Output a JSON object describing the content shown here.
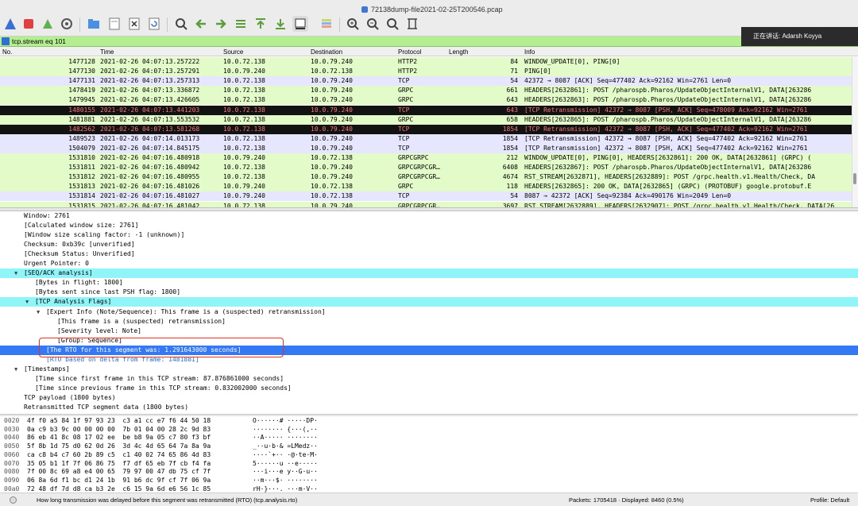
{
  "window": {
    "title": "72138dump-file2021-02-25T200546.pcap"
  },
  "notification": {
    "text": "正在讲话: Adarsh Koyya"
  },
  "filter": {
    "value": "tcp.stream eq 101"
  },
  "columns": [
    "No.",
    "Time",
    "Source",
    "Destination",
    "Protocol",
    "Length",
    "Info"
  ],
  "packets": [
    {
      "no": "1477128",
      "time": "2021-02-26 04:07:13.257222",
      "src": "10.0.72.138",
      "dst": "10.0.79.240",
      "proto": "HTTP2",
      "len": "84",
      "info": "WINDOW_UPDATE[0], PING[0]",
      "style": "g"
    },
    {
      "no": "1477130",
      "time": "2021-02-26 04:07:13.257291",
      "src": "10.0.79.240",
      "dst": "10.0.72.138",
      "proto": "HTTP2",
      "len": "71",
      "info": "PING[0]",
      "style": "g"
    },
    {
      "no": "1477131",
      "time": "2021-02-26 04:07:13.257313",
      "src": "10.0.72.138",
      "dst": "10.0.79.240",
      "proto": "TCP",
      "len": "54",
      "info": "42372 → 8087 [ACK] Seq=477402 Ack=92162 Win=2761 Len=0",
      "style": "l"
    },
    {
      "no": "1478419",
      "time": "2021-02-26 04:07:13.336872",
      "src": "10.0.72.138",
      "dst": "10.0.79.240",
      "proto": "GRPC",
      "len": "661",
      "info": "HEADERS[2632861]: POST /pharospb.Pharos/UpdateObjectInternalV1, DATA[263286",
      "style": "g"
    },
    {
      "no": "1479945",
      "time": "2021-02-26 04:07:13.426605",
      "src": "10.0.72.138",
      "dst": "10.0.79.240",
      "proto": "GRPC",
      "len": "643",
      "info": "HEADERS[2632863]: POST /pharospb.Pharos/UpdateObjectInternalV1, DATA[263286",
      "style": "g"
    },
    {
      "no": "1480155",
      "time": "2021-02-26 04:07:13.441203",
      "src": "10.0.72.138",
      "dst": "10.0.79.240",
      "proto": "TCP",
      "len": "643",
      "info": "[TCP Retransmission] 42372 → 8087 [PSH, ACK] Seq=478009 Ack=92162 Win=2761",
      "style": "k"
    },
    {
      "no": "1481881",
      "time": "2021-02-26 04:07:13.553532",
      "src": "10.0.72.138",
      "dst": "10.0.79.240",
      "proto": "GRPC",
      "len": "658",
      "info": "HEADERS[2632865]: POST /pharospb.Pharos/UpdateObjectInternalV1, DATA[263286",
      "style": "g"
    },
    {
      "no": "1482562",
      "time": "2021-02-26 04:07:13.581268",
      "src": "10.0.72.138",
      "dst": "10.0.79.240",
      "proto": "TCP",
      "len": "1854",
      "info": "[TCP Retransmission] 42372 → 8087 [PSH, ACK] Seq=477402 Ack=92162 Win=2761",
      "style": "k"
    },
    {
      "no": "1489523",
      "time": "2021-02-26 04:07:14.013173",
      "src": "10.0.72.138",
      "dst": "10.0.79.240",
      "proto": "TCP",
      "len": "1854",
      "info": "[TCP Retransmission] 42372 → 8087 [PSH, ACK] Seq=477402 Ack=92162 Win=2761",
      "style": "l"
    },
    {
      "no": "1504079",
      "time": "2021-02-26 04:07:14.845175",
      "src": "10.0.72.138",
      "dst": "10.0.79.240",
      "proto": "TCP",
      "len": "1854",
      "info": "[TCP Retransmission] 42372 → 8087 [PSH, ACK] Seq=477402 Ack=92162 Win=2761",
      "style": "l"
    },
    {
      "no": "1531810",
      "time": "2021-02-26 04:07:16.480918",
      "src": "10.0.79.240",
      "dst": "10.0.72.138",
      "proto": "GRPCGRPC",
      "len": "212",
      "info": "WINDOW_UPDATE[0], PING[0], HEADERS[2632861]: 200 OK, DATA[2632861] (GRPC) (",
      "style": "g"
    },
    {
      "no": "1531811",
      "time": "2021-02-26 04:07:16.480942",
      "src": "10.0.72.138",
      "dst": "10.0.79.240",
      "proto": "GRPCGRPCGR…",
      "len": "6408",
      "info": "HEADERS[2632867]: POST /pharospb.Pharos/UpdateObjectInternalV1, DATA[263286",
      "style": "g"
    },
    {
      "no": "1531812",
      "time": "2021-02-26 04:07:16.480955",
      "src": "10.0.72.138",
      "dst": "10.0.79.240",
      "proto": "GRPCGRPCGR…",
      "len": "4674",
      "info": "RST_STREAM[2632871], HEADERS[2632889]: POST /grpc.health.v1.Health/Check, DA",
      "style": "g"
    },
    {
      "no": "1531813",
      "time": "2021-02-26 04:07:16.481026",
      "src": "10.0.79.240",
      "dst": "10.0.72.138",
      "proto": "GRPC",
      "len": "118",
      "info": "HEADERS[2632865]: 200 OK, DATA[2632865] (GRPC) (PROTOBUF) google.protobuf.E",
      "style": "g"
    },
    {
      "no": "1531814",
      "time": "2021-02-26 04:07:16.481027",
      "src": "10.0.79.240",
      "dst": "10.0.72.138",
      "proto": "TCP",
      "len": "54",
      "info": "8087 → 42372 [ACK] Seq=92384 Ack=490176 Win=2049 Len=0",
      "style": "l"
    },
    {
      "no": "1531815",
      "time": "2021-02-26 04:07:16.481042",
      "src": "10.0.72.138",
      "dst": "10.0.79.240",
      "proto": "GRPCGRPCGR…",
      "len": "3697",
      "info": "RST_STREAM[2632889], HEADERS[2632907]: POST /grpc.health.v1.Health/Check, DATA[26",
      "style": "g"
    }
  ],
  "details": [
    {
      "text": "Window: 2761",
      "indent": 0,
      "tri": "",
      "style": ""
    },
    {
      "text": "[Calculated window size: 2761]",
      "indent": 0,
      "tri": "",
      "style": ""
    },
    {
      "text": "[Window size scaling factor: -1 (unknown)]",
      "indent": 0,
      "tri": "",
      "style": ""
    },
    {
      "text": "Checksum: 0xb39c [unverified]",
      "indent": 0,
      "tri": "",
      "style": ""
    },
    {
      "text": "[Checksum Status: Unverified]",
      "indent": 0,
      "tri": "",
      "style": ""
    },
    {
      "text": "Urgent Pointer: 0",
      "indent": 0,
      "tri": "",
      "style": ""
    },
    {
      "text": "[SEQ/ACK analysis]",
      "indent": 0,
      "tri": "▼",
      "style": "cy"
    },
    {
      "text": "[Bytes in flight: 1800]",
      "indent": 1,
      "tri": "",
      "style": ""
    },
    {
      "text": "[Bytes sent since last PSH flag: 1800]",
      "indent": 1,
      "tri": "",
      "style": ""
    },
    {
      "text": "[TCP Analysis Flags]",
      "indent": 1,
      "tri": "▼",
      "style": "cy"
    },
    {
      "text": "[Expert Info (Note/Sequence): This frame is a (suspected) retransmission]",
      "indent": 2,
      "tri": "▼",
      "style": ""
    },
    {
      "text": "[This frame is a (suspected) retransmission]",
      "indent": 3,
      "tri": "",
      "style": ""
    },
    {
      "text": "[Severity level: Note]",
      "indent": 3,
      "tri": "",
      "style": ""
    },
    {
      "text": "[Group: Sequence]",
      "indent": 3,
      "tri": "",
      "style": ""
    },
    {
      "text": "[The RTO for this segment was: 1.291643000 seconds]",
      "indent": 2,
      "tri": "",
      "style": "sel"
    },
    {
      "text": "[RTO based on delta from frame: 1481881]",
      "indent": 2,
      "tri": "",
      "style": "lnk"
    },
    {
      "text": "[Timestamps]",
      "indent": 0,
      "tri": "▼",
      "style": ""
    },
    {
      "text": "[Time since first frame in this TCP stream: 87.876861000 seconds]",
      "indent": 1,
      "tri": "",
      "style": ""
    },
    {
      "text": "[Time since previous frame in this TCP stream: 0.832002000 seconds]",
      "indent": 1,
      "tri": "",
      "style": ""
    },
    {
      "text": "TCP payload (1800 bytes)",
      "indent": 0,
      "tri": "",
      "style": ""
    },
    {
      "text": "Retransmitted TCP segment data (1800 bytes)",
      "indent": 0,
      "tri": "",
      "style": ""
    }
  ],
  "bytes": [
    {
      "off": "0020",
      "hex": "4f f0 a5 84 1f 97 93 23  c3 a1 cc e7 f6 44 50 18",
      "asc": "O······# ·····DP·"
    },
    {
      "off": "0030",
      "hex": "0a c9 b3 9c 00 00 00 00  7b 01 04 00 28 2c 9d 83",
      "asc": "········ {···(,··"
    },
    {
      "off": "0040",
      "hex": "86 eb 41 8c 08 17 02 ee  be b8 9a 05 c7 80 f3 bf",
      "asc": "··A····· ········"
    },
    {
      "off": "0050",
      "hex": "5f 8b 1d 75 d0 62 0d 26  3d 4c 4d 65 64 7a 8a 9a",
      "asc": "_··u·b·& =LMedz··"
    },
    {
      "off": "0060",
      "hex": "ca c8 b4 c7 60 2b 89 c5  c1 40 02 74 65 86 4d 83",
      "asc": "····`+·· ·@·te·M·"
    },
    {
      "off": "0070",
      "hex": "35 05 b1 1f 7f 06 86 75  f7 df 65 eb 7f cb f4 fa",
      "asc": "5······u ··e·····"
    },
    {
      "off": "0080",
      "hex": "7f 00 8c 69 a8 e4 00 65  79 97 00 47 db 75 cf 7f",
      "asc": "···i···e y··G·u··"
    },
    {
      "off": "0090",
      "hex": "06 8a 6d f1 bc d1 24 1b  91 b6 dc 9f cf 7f 06 9a",
      "asc": "··m···$· ········"
    },
    {
      "off": "00a0",
      "hex": "72 48 df 7d d8 ca b3 2e  c6 15 9a 6d e6 56 1c 85",
      "asc": "rH·}···. ···m·V··"
    }
  ],
  "status": {
    "hint": "How long transmission was delayed before this segment was retransmitted (RTO) (tcp.analysis.rto)",
    "packets": "Packets: 1705418 · Displayed: 8460 (0.5%)",
    "profile": "Profile: Default"
  }
}
